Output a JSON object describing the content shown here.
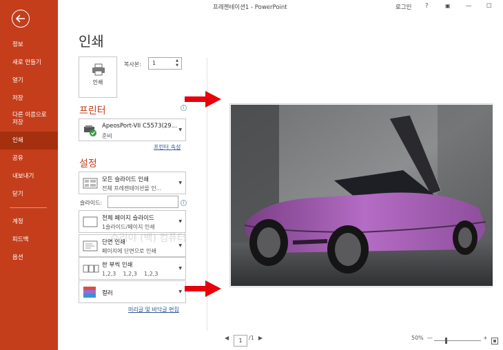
{
  "window": {
    "title": "프레젠테이션1 - PowerPoint",
    "signin": "로그인",
    "help": "?",
    "minimize": "—",
    "restore": "☐",
    "close": "✕"
  },
  "sidebar": {
    "items": [
      {
        "label": "정보"
      },
      {
        "label": "새로 만들기"
      },
      {
        "label": "열기"
      },
      {
        "label": "저장"
      },
      {
        "label": "다른 이름으로\n저장"
      },
      {
        "label": "인쇄"
      },
      {
        "label": "공유"
      },
      {
        "label": "내보내기"
      },
      {
        "label": "닫기"
      },
      {
        "label": "계정"
      },
      {
        "label": "피드백"
      },
      {
        "label": "옵션"
      }
    ]
  },
  "main": {
    "title": "인쇄",
    "print_button": "인쇄",
    "copies_label": "복사본:",
    "copies_value": "1",
    "printer_section": "프린터",
    "printer_name": "ApeosPort-VII C5573(29...",
    "printer_status": "준비",
    "printer_props_link": "프린터 속성",
    "settings_section": "설정",
    "settings": [
      {
        "line1": "모든 슬라이드 인쇄",
        "line2": "전체 프레젠테이션을 인..."
      },
      {
        "line1": "전체 페이지 슬라이드",
        "line2": "1슬라이드/페이지 인쇄"
      },
      {
        "line1": "단면 인쇄",
        "line2": "페이지에 단면으로 인쇄"
      },
      {
        "line1": "한 부씩 인쇄",
        "line2": "1,2,3    1,2,3    1,2,3"
      },
      {
        "line1": "컬러",
        "line2": ""
      }
    ],
    "slides_label": "슬라이드:",
    "slides_value": "",
    "header_footer_link": "머리글 및 바닥글 편집",
    "watermark": "수리야 (백) 컴퓨터"
  },
  "preview_nav": {
    "prev": "◀",
    "page": "1",
    "total": "/1",
    "next": "▶",
    "zoom": "50%",
    "zoom_out": "—",
    "zoom_in": "+"
  },
  "colors": {
    "accent": "#c43e1c",
    "arrow": "#e8000b"
  }
}
